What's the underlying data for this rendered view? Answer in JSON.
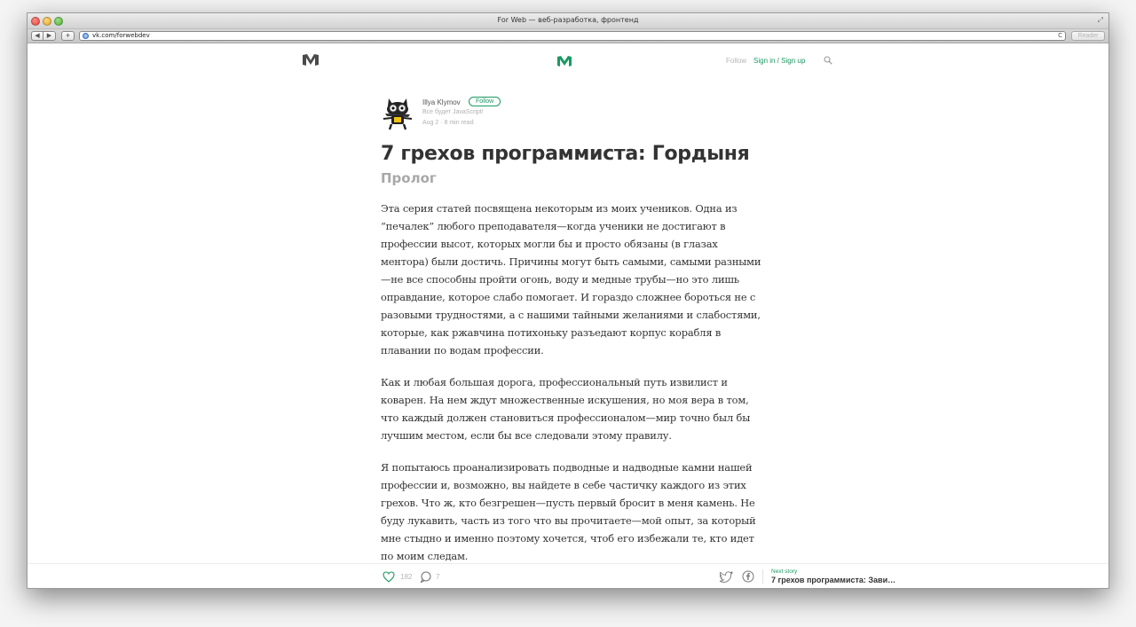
{
  "browser": {
    "window_title": "For Web — веб-разработка, фронтенд",
    "url": "vk.com/forwebdev",
    "reader_label": "Reader",
    "back_glyph": "◀",
    "forward_glyph": "▶",
    "plus_glyph": "+",
    "reload_glyph": "C",
    "fullscreen_glyph": "⤢"
  },
  "header": {
    "follow_label": "Follow",
    "signin_label": "Sign in / Sign up"
  },
  "author": {
    "name": "Illya Klymov",
    "follow_button": "Follow",
    "bio": "Все будет JavaScript!",
    "meta": "Aug 2 · 8 min read"
  },
  "article": {
    "title": "7 грехов программиста: Гордыня",
    "subtitle": "Пролог",
    "paragraphs": [
      "Эта серия статей посвящена некоторым из моих учеников. Одна из “печалек” любого преподавателя—когда ученики не достигают в профессии высот, которых могли бы и просто обязаны (в глазах ментора) были достичь. Причины могут быть самыми, самыми разными—не все способны пройти огонь, воду и медные трубы—но это лишь оправдание, которое слабо помогает. И гораздо сложнее бороться не с разовыми трудностями, а с нашими тайными желаниями и слабостями, которые, как ржавчина потихоньку разъедают корпус корабля в плавании по водам профессии.",
      "Как и любая большая дорога, профессиональный путь извилист и коварен. На нем ждут множественные искушения, но моя вера в том, что каждый должен становиться профессионалом—мир точно был бы лучшим местом, если бы все следовали этому правилу.",
      "Я попытаюсь проанализировать подводные и надводные камни нашей профессии и, возможно, вы найдете в себе частичку каждого из этих грехов. Что ж, кто безгрешен—пусть первый бросит в меня камень. Не буду лукавить, часть из того что вы прочитаете—мой опыт, за который мне стыдно и именно поэтому хочется, чтоб его избежали те, кто идет по моим следам."
    ]
  },
  "footer": {
    "likes": "182",
    "comments": "7",
    "next_label": "Next story",
    "next_title": "7 грехов программиста: Зави…"
  },
  "colors": {
    "accent": "#1c9963",
    "text": "#333333",
    "muted": "#b5b5b5"
  }
}
